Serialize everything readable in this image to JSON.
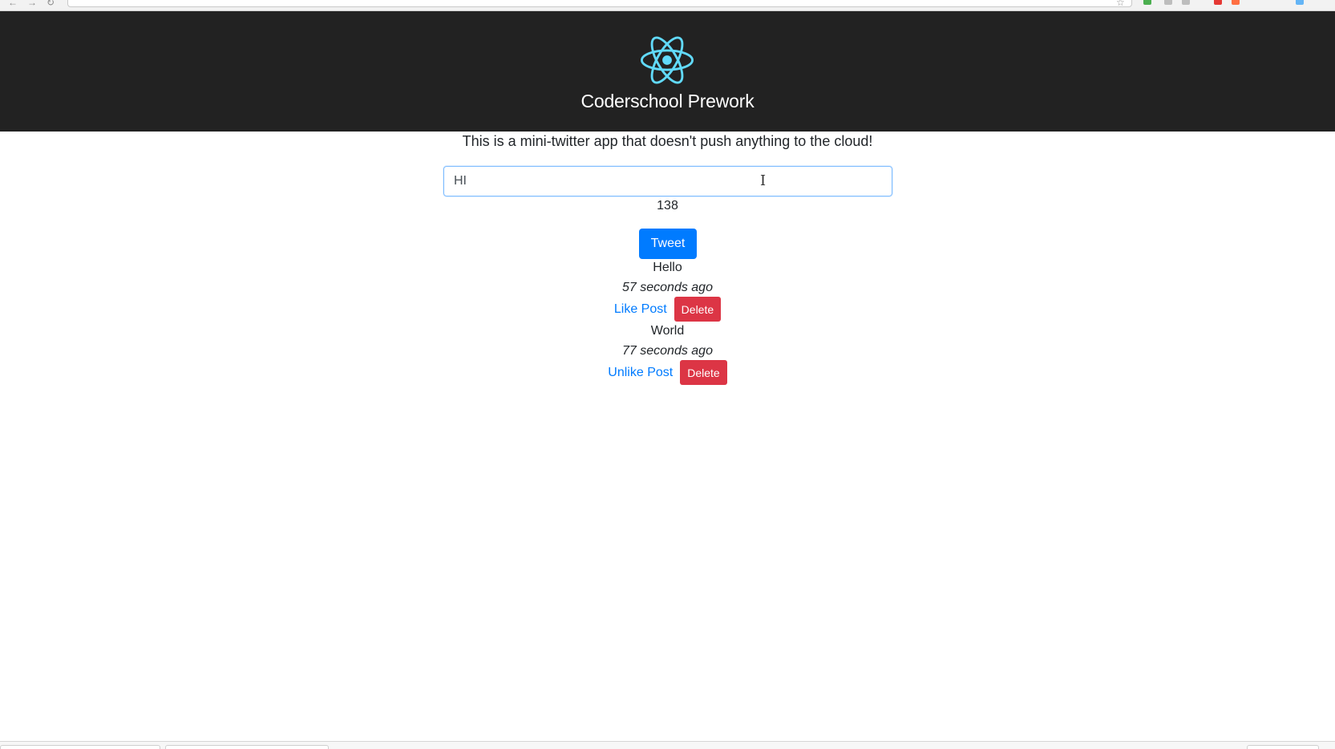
{
  "app": {
    "title": "Coderschool Prework",
    "logo_icon": "react-atom-icon",
    "header_bg": "#222222",
    "logo_color": "#61dafb"
  },
  "main": {
    "intro": "This is a mini-twitter app that doesn't push anything to the cloud!",
    "tweet_input_value": "HI",
    "char_count": "138",
    "tweet_button": "Tweet",
    "accent": "#007bff",
    "danger": "#dc3545"
  },
  "posts": [
    {
      "text": "Hello",
      "time": "57 seconds ago",
      "like_label": "Like Post",
      "delete_label": "Delete"
    },
    {
      "text": "World",
      "time": "77 seconds ago",
      "like_label": "Unlike Post",
      "delete_label": "Delete"
    }
  ]
}
